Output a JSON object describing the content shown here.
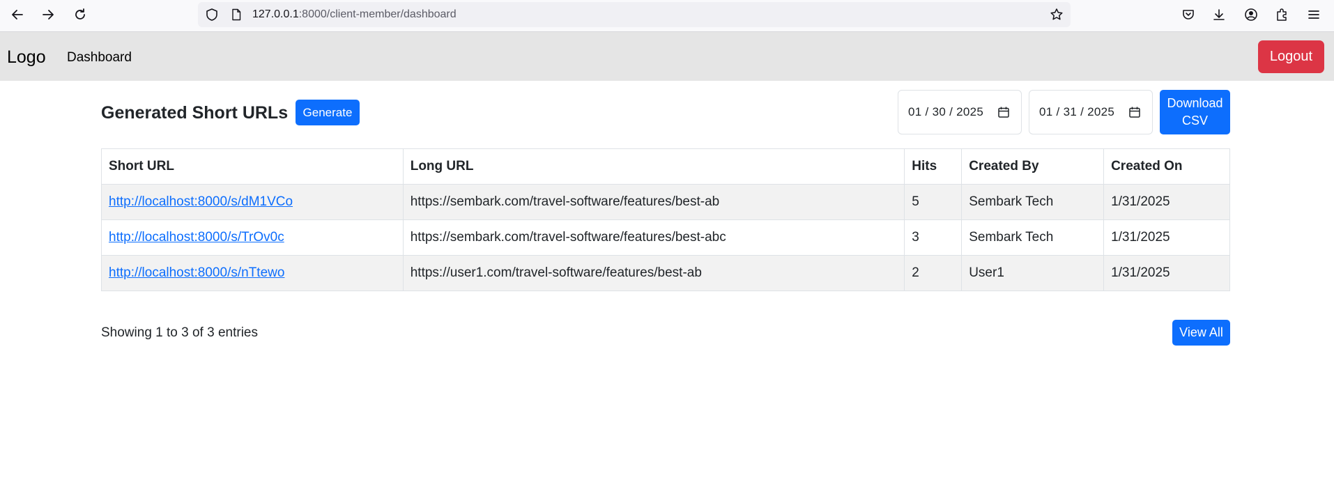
{
  "browser": {
    "url_host": "127.0.0.1",
    "url_rest": ":8000/client-member/dashboard"
  },
  "navbar": {
    "logo": "Logo",
    "dashboard_link": "Dashboard",
    "logout_label": "Logout"
  },
  "header": {
    "title": "Generated Short URLs",
    "generate_label": "Generate",
    "date_from": "01 / 30 / 2025",
    "date_to": "01 / 31 / 2025",
    "download_label": "Download CSV"
  },
  "table": {
    "columns": [
      "Short URL",
      "Long URL",
      "Hits",
      "Created By",
      "Created On"
    ],
    "rows": [
      {
        "short_url": "http://localhost:8000/s/dM1VCo",
        "long_url": "https://sembark.com/travel-software/features/best-ab",
        "hits": "5",
        "created_by": "Sembark Tech",
        "created_on": "1/31/2025"
      },
      {
        "short_url": "http://localhost:8000/s/TrOv0c",
        "long_url": "https://sembark.com/travel-software/features/best-abc",
        "hits": "3",
        "created_by": "Sembark Tech",
        "created_on": "1/31/2025"
      },
      {
        "short_url": "http://localhost:8000/s/nTtewo",
        "long_url": "https://user1.com/travel-software/features/best-ab",
        "hits": "2",
        "created_by": "User1",
        "created_on": "1/31/2025"
      }
    ]
  },
  "footer": {
    "entries_text": "Showing 1 to 3 of 3 entries",
    "view_all_label": "View All"
  },
  "colors": {
    "primary": "#0d6efd",
    "danger": "#dc3545",
    "navbar_bg": "#e5e5e5",
    "striped_row": "#f2f2f2"
  },
  "icons": [
    "back-arrow-icon",
    "forward-arrow-icon",
    "reload-icon",
    "shield-icon",
    "page-icon",
    "bookmark-star-icon",
    "pocket-icon",
    "download-icon",
    "account-icon",
    "extensions-icon",
    "menu-icon",
    "calendar-icon"
  ]
}
